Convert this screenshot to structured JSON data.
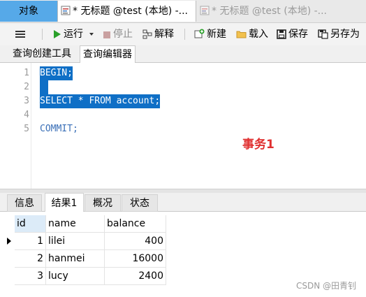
{
  "doc_tabs": {
    "objects": "对象",
    "active": "* 无标题 @test (本地) -...",
    "inactive": "* 无标题 @test (本地) -..."
  },
  "toolbar": {
    "run": "运行",
    "stop": "停止",
    "explain": "解释",
    "new": "新建",
    "load": "载入",
    "save": "保存",
    "save_as": "另存为"
  },
  "sub_tabs": {
    "query_builder": "查询创建工具",
    "query_editor": "查询编辑器"
  },
  "editor": {
    "line_numbers": [
      "1",
      "2",
      "3",
      "4",
      "5"
    ],
    "lines": [
      "BEGIN;",
      " ",
      "SELECT * FROM account;",
      "",
      "COMMIT;"
    ],
    "annotation": "事务1"
  },
  "result_tabs": {
    "info": "信息",
    "result1": "结果1",
    "overview": "概况",
    "status": "状态"
  },
  "grid": {
    "columns": [
      "id",
      "name",
      "balance"
    ],
    "rows": [
      [
        "1",
        "lilei",
        "400"
      ],
      [
        "2",
        "hanmei",
        "16000"
      ],
      [
        "3",
        "lucy",
        "2400"
      ]
    ]
  },
  "watermark": "CSDN @田青钊",
  "colors": {
    "selection": "#0f6fc6",
    "objects_tab": "#56a9e8",
    "annotation": "#e03030",
    "run_icon": "#2aa02a"
  }
}
